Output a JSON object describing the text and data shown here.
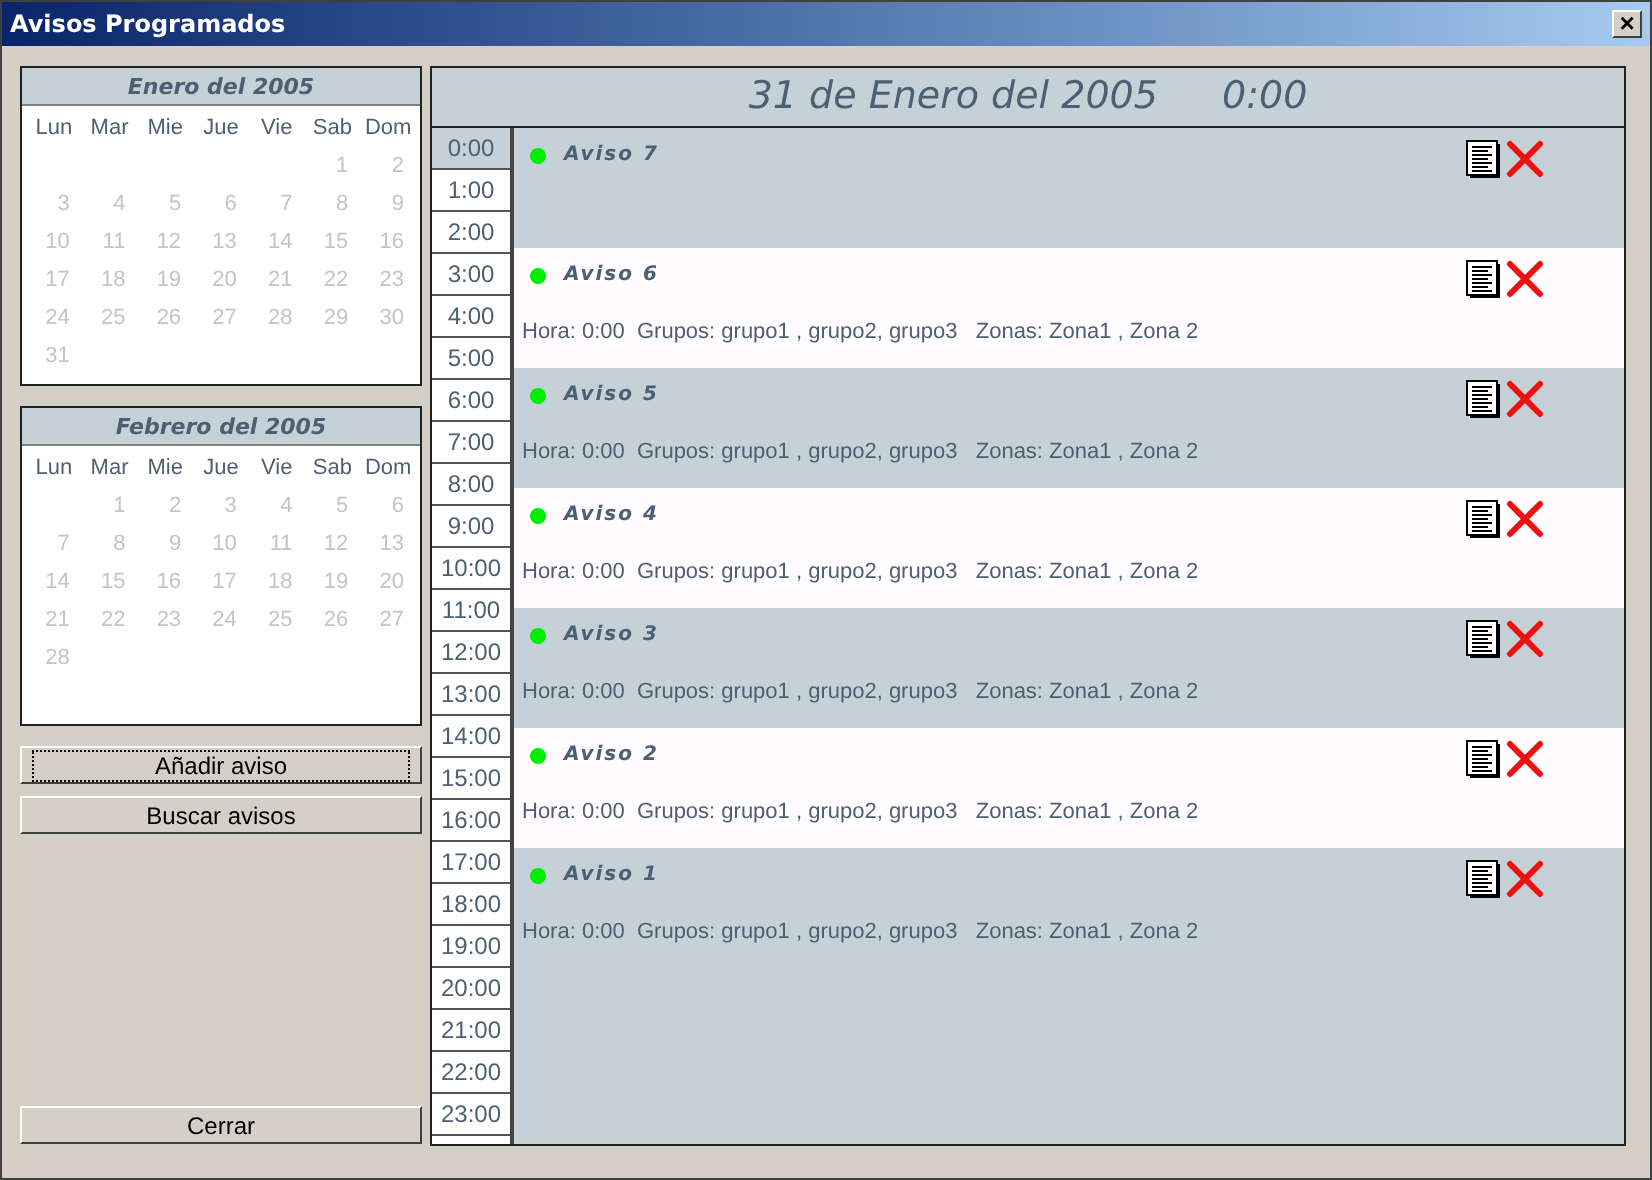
{
  "window": {
    "title": "Avisos Programados",
    "close": "×"
  },
  "calendars": [
    {
      "title": "Enero del 2005",
      "disabled": true,
      "weekdays": [
        "Lun",
        "Mar",
        "Mie",
        "Jue",
        "Vie",
        "Sab",
        "Dom"
      ],
      "weeks": [
        {
          "kind": "lead",
          "days": [
            "1",
            "2"
          ]
        },
        {
          "kind": "week",
          "days": [
            "3",
            "4",
            "5",
            "6",
            "7",
            "8",
            "9"
          ]
        },
        {
          "kind": "week",
          "days": [
            "10",
            "11",
            "12",
            "13",
            "14",
            "15",
            "16"
          ]
        },
        {
          "kind": "week",
          "days": [
            "17",
            "18",
            "19",
            "20",
            "21",
            "22",
            "23"
          ]
        },
        {
          "kind": "week",
          "days": [
            "24",
            "25",
            "26",
            "27",
            "28",
            "29",
            "30"
          ]
        },
        {
          "kind": "week",
          "days": [
            "31"
          ]
        }
      ]
    },
    {
      "title": "Febrero del 2005",
      "disabled": true,
      "weekdays": [
        "Lun",
        "Mar",
        "Mie",
        "Jue",
        "Vie",
        "Sab",
        "Dom"
      ],
      "weeks": [
        {
          "kind": "lead",
          "days": [
            "1",
            "2",
            "3",
            "4",
            "5",
            "6"
          ]
        },
        {
          "kind": "week",
          "days": [
            "7",
            "8",
            "9",
            "10",
            "11",
            "12",
            "13"
          ]
        },
        {
          "kind": "week",
          "days": [
            "14",
            "15",
            "16",
            "17",
            "18",
            "19",
            "20"
          ]
        },
        {
          "kind": "week",
          "days": [
            "21",
            "22",
            "23",
            "24",
            "25",
            "26",
            "27"
          ]
        },
        {
          "kind": "week",
          "days": [
            "28"
          ]
        }
      ]
    }
  ],
  "buttons": [
    {
      "label": "Añadir aviso",
      "focused": true
    },
    {
      "label": "Buscar avisos",
      "focused": false
    }
  ],
  "close_button": "Cerrar",
  "day_header": {
    "date": "31 de Enero del 2005",
    "time": "0:00"
  },
  "hours": [
    {
      "label": "0:00",
      "selected": true
    },
    {
      "label": "1:00",
      "selected": false
    },
    {
      "label": "2:00",
      "selected": false
    },
    {
      "label": "3:00",
      "selected": false
    },
    {
      "label": "4:00",
      "selected": false
    },
    {
      "label": "5:00",
      "selected": false
    },
    {
      "label": "6:00",
      "selected": false
    },
    {
      "label": "7:00",
      "selected": false
    },
    {
      "label": "8:00",
      "selected": false
    },
    {
      "label": "9:00",
      "selected": false
    },
    {
      "label": "10:00",
      "selected": false
    },
    {
      "label": "11:00",
      "selected": false
    },
    {
      "label": "12:00",
      "selected": false
    },
    {
      "label": "13:00",
      "selected": false
    },
    {
      "label": "14:00",
      "selected": false
    },
    {
      "label": "15:00",
      "selected": false
    },
    {
      "label": "16:00",
      "selected": false
    },
    {
      "label": "17:00",
      "selected": false
    },
    {
      "label": "18:00",
      "selected": false
    },
    {
      "label": "19:00",
      "selected": false
    },
    {
      "label": "20:00",
      "selected": false
    },
    {
      "label": "21:00",
      "selected": false
    },
    {
      "label": "22:00",
      "selected": false
    },
    {
      "label": "23:00",
      "selected": false
    }
  ],
  "notices": [
    {
      "title": "Aviso 7",
      "color": "#00ee00"
    },
    {
      "title": "Aviso 6",
      "color": "#00ee00",
      "details": "Hora: 0:00  Grupos: grupo1 , grupo2, grupo3   Zonas: Zona1 , Zona 2"
    },
    {
      "title": "Aviso 5",
      "color": "#00ee00",
      "details": "Hora: 0:00  Grupos: grupo1 , grupo2, grupo3   Zonas: Zona1 , Zona 2"
    },
    {
      "title": "Aviso 4",
      "color": "#00ee00",
      "details": "Hora: 0:00  Grupos: grupo1 , grupo2, grupo3   Zonas: Zona1 , Zona 2"
    },
    {
      "title": "Aviso 3",
      "color": "#00ee00",
      "details": "Hora: 0:00  Grupos: grupo1 , grupo2, grupo3   Zonas: Zona1 , Zona 2"
    },
    {
      "title": "Aviso 2",
      "color": "#00ee00",
      "details": "Hora: 0:00  Grupos: grupo1 , grupo2, grupo3   Zonas: Zona1 , Zona 2"
    },
    {
      "title": "Aviso 1",
      "color": "#00ee00",
      "details": "Hora: 0:00  Grupos: grupo1 , grupo2, grupo3   Zonas: Zona1 , Zona 2"
    }
  ]
}
